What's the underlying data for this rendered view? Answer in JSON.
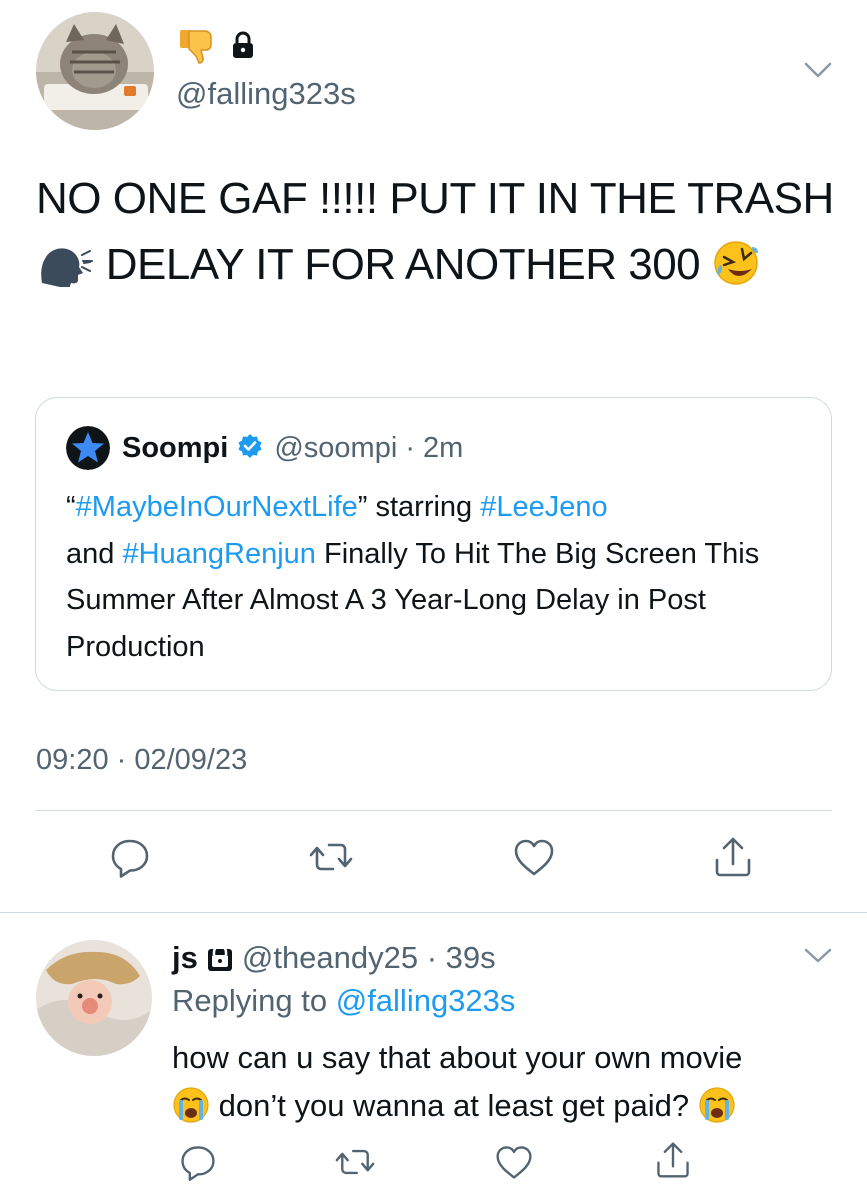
{
  "main_tweet": {
    "handle": "@falling323s",
    "text_part1": "NO ONE GAF !!!!! PUT IT IN THE TRASH",
    "text_part2": "DELAY IT FOR ANOTHER 300",
    "timestamp": "09:20 · 02/09/23",
    "emoji": {
      "name_emoji": "thumbs-down-icon",
      "lock": "lock-icon",
      "speaking": "speaking-head-icon",
      "laughing": "rolling-laughing-icon"
    }
  },
  "quote": {
    "name": "Soompi",
    "meta": "@soompi · 2m",
    "body_q_open": "“",
    "hashtag_1": "#MaybeInOurNextLife",
    "body_q_close": "” starring ",
    "hashtag_2": "#LeeJeno",
    "body_and": "and ",
    "hashtag_3": "#HuangRenjun",
    "body_rest": " Finally To Hit The Big Screen This Summer After Almost A 3 Year-Long Delay in Post Production"
  },
  "reply": {
    "name": "js",
    "meta": "@theandy25 · 39s",
    "replying_label": "Replying to ",
    "replying_handle": "@falling323s",
    "text_part1": "how can u say that about your own movie",
    "text_part2": "don’t you wanna at least get paid?"
  },
  "colors": {
    "accent": "#1d9bf0",
    "secondary_text": "#536471",
    "border": "#cfd9de"
  }
}
